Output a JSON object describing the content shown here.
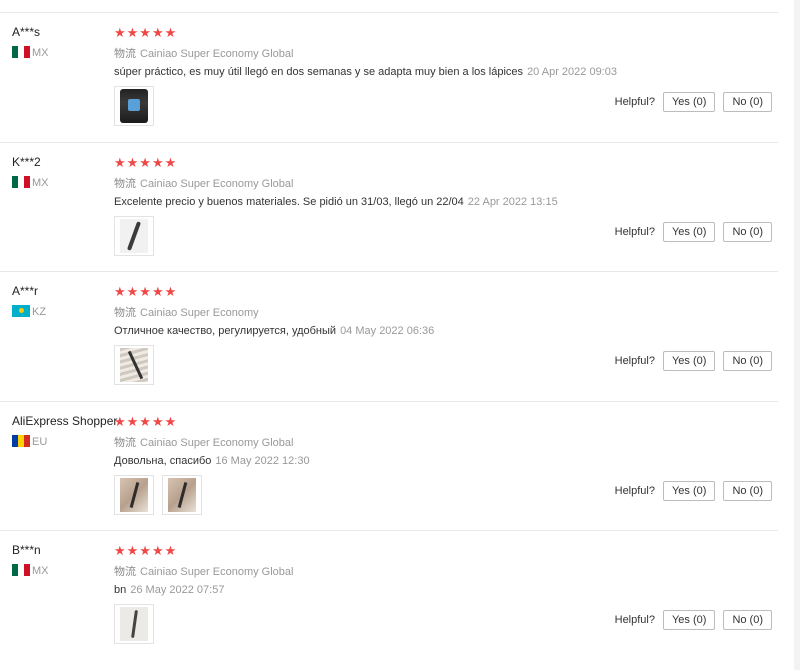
{
  "helpful_label": "Helpful?",
  "reviews": [
    {
      "user": "A***s",
      "country": "MX",
      "rating": "★★★★★",
      "logistics_label": "物流",
      "logistics": "Cainiao Super Economy Global",
      "comment": "súper práctico, es muy útil llegó en dos semanas y se adapta muy bien a los lápices",
      "date": "20 Apr 2022 09:03",
      "yes": "Yes (0)",
      "no": "No (0)"
    },
    {
      "user": "K***2",
      "country": "MX",
      "rating": "★★★★★",
      "logistics_label": "物流",
      "logistics": "Cainiao Super Economy Global",
      "comment": "Excelente precio y buenos materiales. Se pidió un 31/03, llegó un 22/04",
      "date": "22 Apr 2022 13:15",
      "yes": "Yes (0)",
      "no": "No (0)"
    },
    {
      "user": "A***r",
      "country": "KZ",
      "rating": "★★★★★",
      "logistics_label": "物流",
      "logistics": "Cainiao Super Economy",
      "comment": "Отличное качество, регулируется, удобный",
      "date": "04 May 2022 06:36",
      "yes": "Yes (0)",
      "no": "No (0)"
    },
    {
      "user": "AliExpress Shopper",
      "country": "EU",
      "rating": "★★★★★",
      "logistics_label": "物流",
      "logistics": "Cainiao Super Economy Global",
      "comment": "Довольна, спасибо",
      "date": "16 May 2022 12:30",
      "yes": "Yes (0)",
      "no": "No (0)"
    },
    {
      "user": "B***n",
      "country": "MX",
      "rating": "★★★★★",
      "logistics_label": "物流",
      "logistics": "Cainiao Super Economy Global",
      "comment": "bn",
      "date": "26 May 2022 07:57",
      "yes": "Yes (0)",
      "no": "No (0)"
    }
  ]
}
